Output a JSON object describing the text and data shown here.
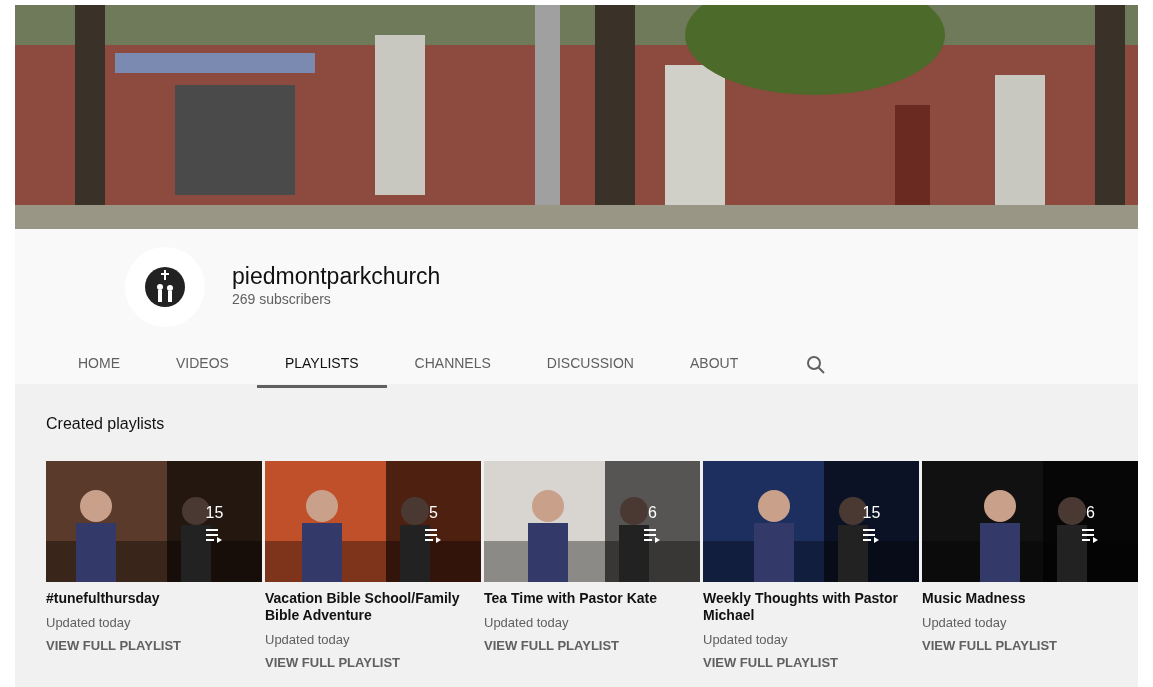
{
  "channel": {
    "name": "piedmontparkchurch",
    "subscribers": "269 subscribers"
  },
  "tabs": [
    {
      "label": "HOME",
      "selected": false
    },
    {
      "label": "VIDEOS",
      "selected": false
    },
    {
      "label": "PLAYLISTS",
      "selected": true
    },
    {
      "label": "CHANNELS",
      "selected": false
    },
    {
      "label": "DISCUSSION",
      "selected": false
    },
    {
      "label": "ABOUT",
      "selected": false
    }
  ],
  "section_title": "Created playlists",
  "playlists": [
    {
      "title": "#tunefulthursday",
      "count": "15",
      "updated": "Updated today",
      "link": "VIEW FULL PLAYLIST"
    },
    {
      "title": "Vacation Bible School/Family Bible Adventure",
      "count": "5",
      "updated": "Updated today",
      "link": "VIEW FULL PLAYLIST"
    },
    {
      "title": "Tea Time with Pastor Kate",
      "count": "6",
      "updated": "Updated today",
      "link": "VIEW FULL PLAYLIST"
    },
    {
      "title": "Weekly Thoughts with Pastor Michael",
      "count": "15",
      "updated": "Updated today",
      "link": "VIEW FULL PLAYLIST"
    },
    {
      "title": "Music Madness",
      "count": "6",
      "updated": "Updated today",
      "link": "VIEW FULL PLAYLIST"
    }
  ]
}
